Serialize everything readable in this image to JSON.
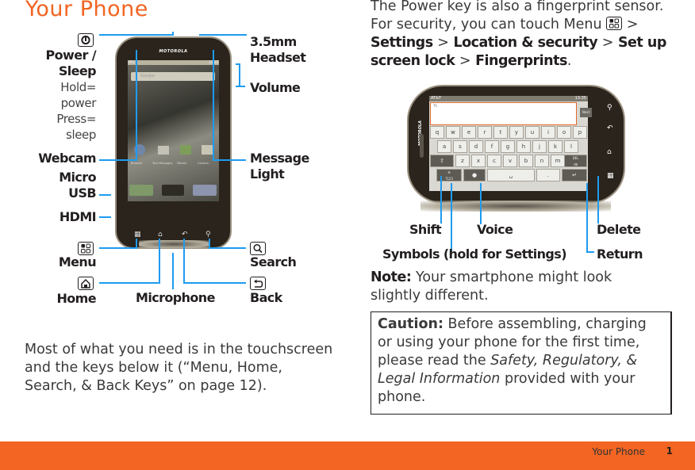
{
  "page": {
    "title": "Your Phone"
  },
  "callouts_left": {
    "power_sleep": "Power / Sleep",
    "power_sleep_line1": "Power /",
    "power_sleep_line2": "Sleep",
    "hold": "Hold=",
    "power": "power",
    "press": "Press=",
    "sleep": "sleep",
    "webcam": "Webcam",
    "micro": "Micro",
    "usb": "USB",
    "hdmi": "HDMI",
    "menu": "Menu",
    "home": "Home"
  },
  "callouts_right": {
    "headset_line1": "3.5mm",
    "headset_line2": "Headset",
    "volume": "Volume",
    "message_line1": "Message",
    "message_line2": "Light",
    "search": "Search",
    "back": "Back"
  },
  "callouts_bottom": {
    "microphone": "Microphone"
  },
  "phone_portrait": {
    "brand": "MOTOROLA",
    "carrier": "AT&T",
    "time": "13:35",
    "search_placeholder": "Google",
    "apps": [
      "Browser",
      "Text Messages",
      "Market",
      "Camera"
    ]
  },
  "intro": {
    "text": "Most of what you need is in the touchscreen and the keys below it (“Menu, Home, Search, & Back Keys” on page 12)."
  },
  "fingerprint": {
    "line1": "The Power key is also a fingerprint sensor.",
    "line2_prefix": "For security, you can touch Menu",
    "sep": ">",
    "steps": [
      "Settings",
      "Location & security",
      "Set up screen lock",
      "Fingerprints"
    ],
    "end": "."
  },
  "phone_landscape": {
    "brand": "MOTOROLA",
    "carrier": "AT&T",
    "time": "13:35",
    "to_placeholder": "To",
    "next_label": "Next",
    "rows": [
      [
        "q",
        "w",
        "e",
        "r",
        "t",
        "y",
        "u",
        "i",
        "o",
        "p"
      ],
      [
        "a",
        "s",
        "d",
        "f",
        "g",
        "h",
        "j",
        "k",
        "l"
      ],
      [
        "z",
        "x",
        "c",
        "v",
        "b",
        "n",
        "m"
      ]
    ],
    "del_label": "DEL",
    "sym_label": "?123"
  },
  "keyboard_callouts": {
    "shift": "Shift",
    "voice": "Voice",
    "delete": "Delete",
    "symbols": "Symbols (hold for Settings)",
    "return": "Return"
  },
  "note": {
    "label": "Note:",
    "text": "Your smartphone might look slightly different."
  },
  "caution": {
    "label": "Caution:",
    "text1": "Before assembling, charging or using your phone for the first time, please read the",
    "italic": "Safety, Regulatory, & Legal Information",
    "text2": "provided with your phone."
  },
  "footer": {
    "section": "Your Phone",
    "page_number": "1"
  },
  "colors": {
    "accent": "#f26522",
    "callout_line": "#1e9bf0",
    "text": "#231f20"
  }
}
